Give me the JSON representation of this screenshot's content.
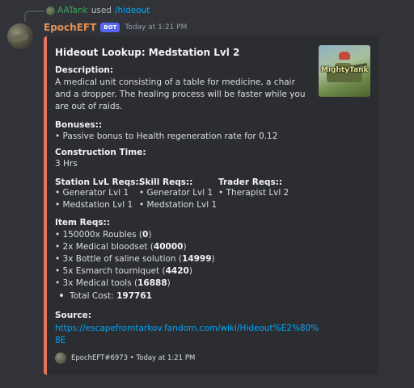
{
  "reply": {
    "username": "AATank",
    "used_text": "used",
    "command": "/hideout"
  },
  "message": {
    "author": "EpochEFT",
    "bot_tag": "BOT",
    "timestamp": "Today at 1:21 PM"
  },
  "embed": {
    "accent_color": "#e0755c",
    "title": "Hideout Lookup: Medstation Lvl 2",
    "thumbnail_text": "MightyTank",
    "description_label": "Description:",
    "description": "A medical unit consisting of a table for medicine, a chair and a dropper. The healing process will be faster while you are out of raids.",
    "bonuses_label": "Bonuses::",
    "bonuses": "• Passive bonus to Health regeneration rate for 0.12",
    "construction_label": "Construction Time:",
    "construction": "3 Hrs",
    "station_reqs": {
      "label": "Station LvL Reqs::",
      "items": [
        "• Generator Lvl 1",
        "• Medstation Lvl 1"
      ]
    },
    "skill_reqs": {
      "label": "Skill Reqs::",
      "items": [
        "• Generator Lvl 1",
        "• Medstation Lvl 1"
      ]
    },
    "trader_reqs": {
      "label": "Trader Reqs::",
      "items": [
        "• Therapist Lvl 2"
      ]
    },
    "item_reqs_label": "Item Reqs::",
    "item_reqs": [
      {
        "name": "• 150000x Roubles (",
        "cost": "0",
        "close": ")"
      },
      {
        "name": "• 2x Medical bloodset (",
        "cost": "40000",
        "close": ")"
      },
      {
        "name": "• 3x Bottle of saline solution (",
        "cost": "14999",
        "close": ")"
      },
      {
        "name": "• 5x Esmarch tourniquet (",
        "cost": "4420",
        "close": ")"
      },
      {
        "name": "• 3x Medical tools (",
        "cost": "16888",
        "close": ")"
      }
    ],
    "total_label": "Total Cost:",
    "total_value": "197761",
    "source_label": "Source:",
    "source_line1": "https://escapefromtarkov.fandom.com/wiki/Hideout%E2%80%",
    "source_line2": "8E",
    "footer": "EpochEFT#6973 • Today at 1:21 PM"
  }
}
